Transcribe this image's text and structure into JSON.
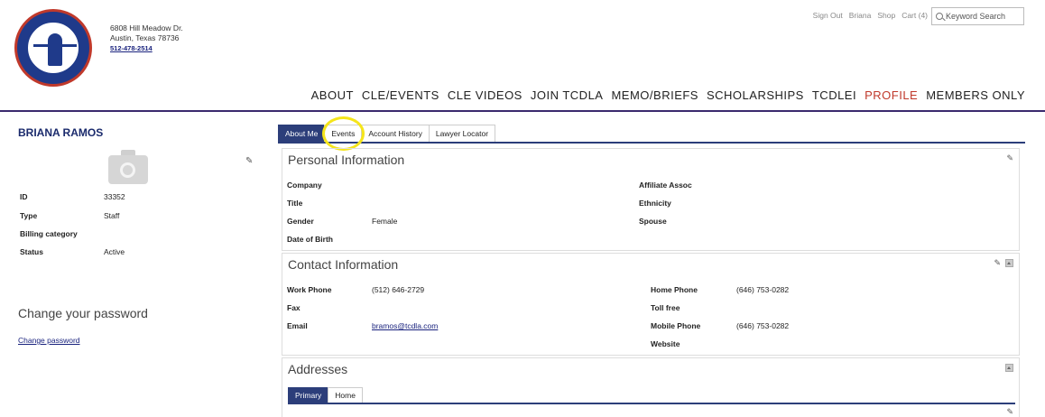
{
  "org": {
    "address_line1": "6808 Hill Meadow Dr.",
    "address_line2": "Austin, Texas 78736",
    "phone": "512-478-2514"
  },
  "util_nav": [
    "Sign Out",
    "Briana",
    "Shop",
    "Cart (4)"
  ],
  "search": {
    "placeholder": "Keyword Search"
  },
  "main_nav": [
    {
      "label": "ABOUT"
    },
    {
      "label": "CLE/EVENTS"
    },
    {
      "label": "CLE VIDEOS"
    },
    {
      "label": "JOIN TCDLA"
    },
    {
      "label": "MEMO/BRIEFS"
    },
    {
      "label": "SCHOLARSHIPS"
    },
    {
      "label": "TCDLEI"
    },
    {
      "label": "PROFILE",
      "active": true
    },
    {
      "label": "MEMBERS ONLY"
    }
  ],
  "profile": {
    "name": "BRIANA RAMOS",
    "fields": [
      {
        "label": "ID",
        "value": "33352"
      },
      {
        "label": "Type",
        "value": "Staff"
      },
      {
        "label": "Billing category",
        "value": ""
      },
      {
        "label": "Status",
        "value": "Active"
      }
    ],
    "password_title": "Change your password",
    "password_link": "Change password"
  },
  "tabs": [
    "About Me",
    "Events",
    "Account History",
    "Lawyer Locator"
  ],
  "personal": {
    "title": "Personal Information",
    "left": [
      {
        "label": "Company",
        "value": ""
      },
      {
        "label": "Title",
        "value": ""
      },
      {
        "label": "Gender",
        "value": "Female"
      },
      {
        "label": "Date of Birth",
        "value": ""
      }
    ],
    "right": [
      {
        "label": "Affiliate Assoc",
        "value": ""
      },
      {
        "label": "Ethnicity",
        "value": ""
      },
      {
        "label": "Spouse",
        "value": ""
      }
    ]
  },
  "contact": {
    "title": "Contact Information",
    "left": [
      {
        "label": "Work Phone",
        "value": "(512) 646-2729"
      },
      {
        "label": "Fax",
        "value": ""
      },
      {
        "label": "Email",
        "value": "bramos@tcdla.com"
      }
    ],
    "right": [
      {
        "label": "Home Phone",
        "value": "(646) 753-0282"
      },
      {
        "label": "Toll free",
        "value": ""
      },
      {
        "label": "Mobile Phone",
        "value": "(646) 753-0282"
      },
      {
        "label": "Website",
        "value": ""
      }
    ]
  },
  "addresses": {
    "title": "Addresses",
    "tabs": [
      "Primary",
      "Home"
    ]
  },
  "icons": {
    "edit": "pencil-icon",
    "collapse": "collapse-arrow-icon",
    "camera": "camera-icon",
    "search": "search-icon"
  },
  "colors": {
    "accent": "#2c3e7a",
    "active_nav": "#c0392b",
    "highlight": "#f5e51b"
  }
}
